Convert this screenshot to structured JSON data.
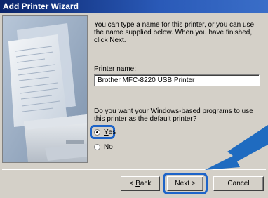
{
  "window": {
    "title": "Add Printer Wizard"
  },
  "content": {
    "intro": "You can type a name for this printer, or you can use the name supplied below. When you have finished, click Next.",
    "printer_name_label_first": "P",
    "printer_name_label_rest": "rinter name:",
    "printer_name_value": "Brother  MFC-8220 USB Printer",
    "default_question": "Do you want your Windows-based programs to use this printer as the default printer?",
    "options": [
      {
        "underlined": "Y",
        "rest": "es",
        "selected": true
      },
      {
        "underlined": "N",
        "rest": "o",
        "selected": false
      }
    ]
  },
  "buttons": {
    "back_prefix": "< ",
    "back_underlined": "B",
    "back_rest": "ack",
    "next": "Next >",
    "cancel": "Cancel"
  },
  "colors": {
    "highlight": "#1e64c8",
    "arrow": "#1565c0",
    "titlebar": "#0a246a"
  }
}
